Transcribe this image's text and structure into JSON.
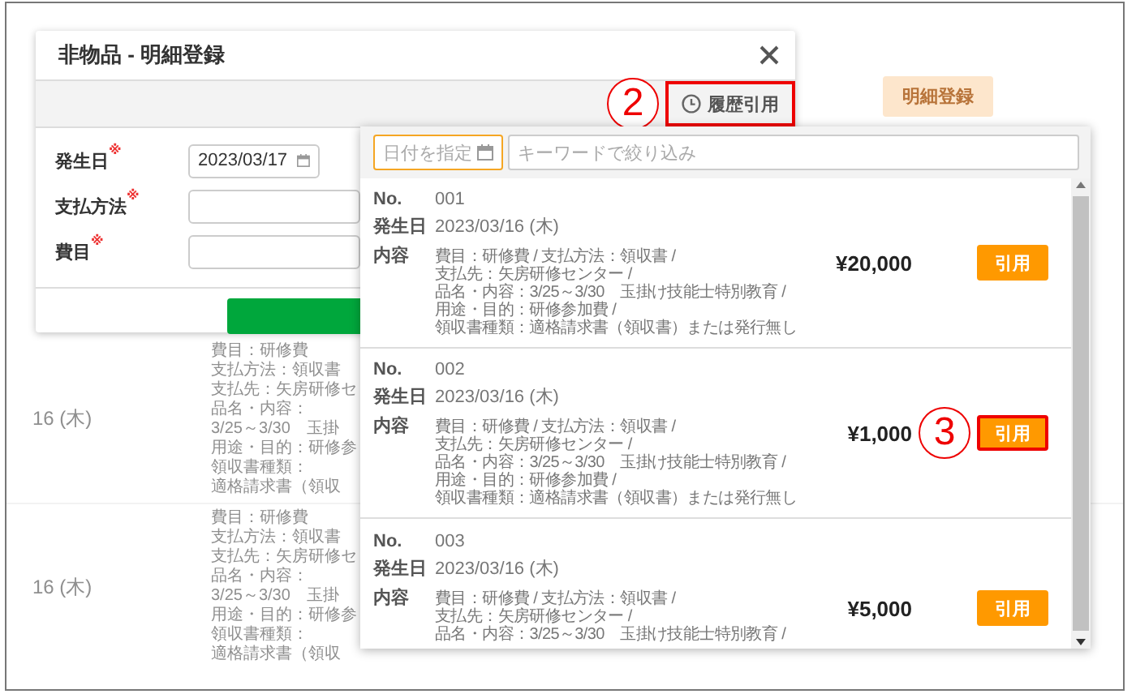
{
  "background": {
    "header_button": "明細登録",
    "rows": [
      {
        "date": "16 (木)",
        "lines": [
          "費目：研修費",
          "支払方法：領収書",
          "支払先：矢房研修セ",
          "品名・内容：",
          "3/25～3/30　玉掛",
          "用途・目的：研修参",
          "領収書種類：",
          "適格請求書（領収"
        ]
      },
      {
        "date": "16 (木)",
        "lines": [
          "費目：研修費",
          "支払方法：領収書",
          "支払先：矢房研修セ",
          "品名・内容：",
          "3/25～3/30　玉掛",
          "用途・目的：研修参",
          "領収書種類：",
          "適格請求書（領収"
        ]
      }
    ]
  },
  "dialog": {
    "title": "非物品 - 明細登録",
    "history_button": {
      "label": "履歴引用",
      "highlighted": true,
      "annotation": "2"
    },
    "fields": [
      {
        "kind": "date",
        "label": "発生日",
        "required_mark": "※",
        "value": "2023/03/17"
      },
      {
        "kind": "text",
        "label": "支払方法",
        "required_mark": "※"
      },
      {
        "kind": "text",
        "label": "費目",
        "required_mark": "※"
      }
    ]
  },
  "history_popup": {
    "date_filter": {
      "placeholder": "日付を指定",
      "focused": true
    },
    "keyword_filter": {
      "placeholder": "キーワードで絞り込み",
      "focused": false
    },
    "items": [
      {
        "no_label": "No.",
        "no": "001",
        "date_label": "発生日",
        "date": "2023/03/16 (木)",
        "content_label": "内容",
        "details": [
          "費目：研修費 / 支払方法：領収書 /",
          "支払先：矢房研修センター /",
          "品名・内容：3/25～3/30　玉掛け技能士特別教育 /",
          "用途・目的：研修参加費 /",
          "領収書種類：適格請求書（領収書）または発行無し"
        ],
        "amount": "¥20,000",
        "button": "引用",
        "highlighted": false
      },
      {
        "no_label": "No.",
        "no": "002",
        "date_label": "発生日",
        "date": "2023/03/16 (木)",
        "content_label": "内容",
        "details": [
          "費目：研修費 / 支払方法：領収書 /",
          "支払先：矢房研修センター /",
          "品名・内容：3/25～3/30　玉掛け技能士特別教育 /",
          "用途・目的：研修参加費 /",
          "領収書種類：適格請求書（領収書）または発行無し"
        ],
        "amount": "¥1,000",
        "button": "引用",
        "highlighted": true,
        "annotation": "3"
      },
      {
        "no_label": "No.",
        "no": "003",
        "date_label": "発生日",
        "date": "2023/03/16 (木)",
        "content_label": "内容",
        "details": [
          "費目：研修費 / 支払方法：領収書 /",
          "支払先：矢房研修センター /",
          "品名・内容：3/25～3/30　玉掛け技能士特別教育 /"
        ],
        "amount": "¥5,000",
        "button": "引用",
        "highlighted": false
      }
    ]
  }
}
